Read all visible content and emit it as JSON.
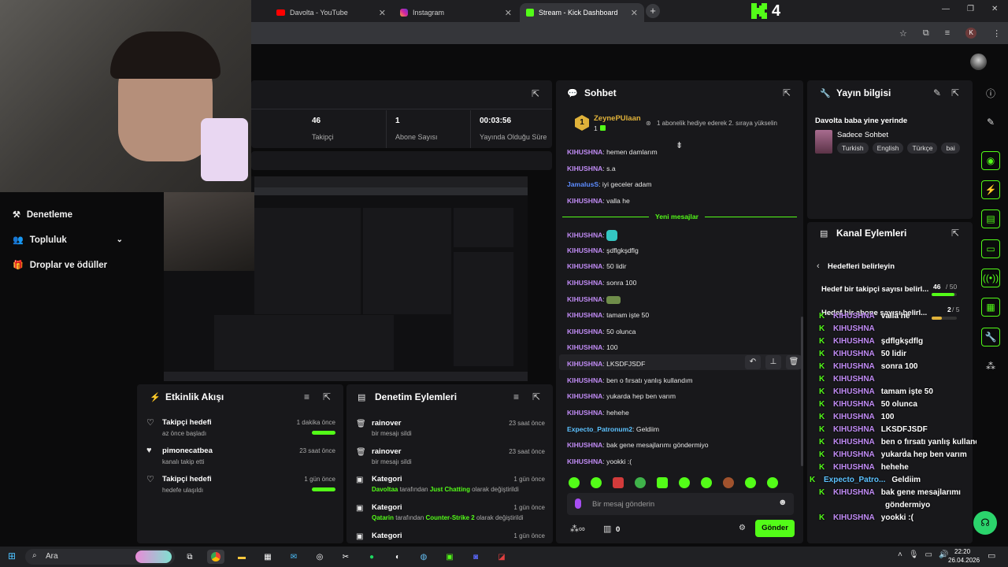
{
  "browser": {
    "tabs": [
      {
        "label": "Davolta - YouTube",
        "icon": "youtube-icon"
      },
      {
        "label": "Instagram",
        "icon": "instagram-icon"
      },
      {
        "label": "Stream - Kick Dashboard",
        "icon": "kick-icon"
      }
    ],
    "logo_text": "4",
    "profile_initial": "K"
  },
  "sidebar": {
    "items": [
      {
        "label": "Denetleme",
        "icon": "shield-icon"
      },
      {
        "label": "Topluluk",
        "icon": "community-icon"
      },
      {
        "label": "Droplar ve ödüller",
        "icon": "gift-icon"
      }
    ]
  },
  "stats": {
    "followers_value": "46",
    "followers_label": "Takipçi",
    "subs_value": "1",
    "subs_label": "Abone Sayısı",
    "uptime_value": "00:03:56",
    "uptime_label": "Yayında Olduğu Süre"
  },
  "chat": {
    "title": "Sohbet",
    "pinned_user": "ZeynePUlaan",
    "pinned_rank": "1",
    "pinned_count": "1",
    "pinned_text": "1 abonelik hediye ederek 2. sıraya yükselin",
    "new_messages_label": "Yeni mesajlar",
    "messages_before": [
      {
        "user": "KIHUSHNA",
        "text": "hemen damlarım"
      },
      {
        "user": "KIHUSHNA",
        "text": "s.a"
      },
      {
        "user": "JamalusS",
        "text": "iyi geceler adam"
      },
      {
        "user": "KIHUSHNA",
        "text": "valla he"
      }
    ],
    "messages_after": [
      {
        "user": "KIHUSHNA",
        "text": ""
      },
      {
        "user": "KIHUSHNA",
        "text": "şdflgkşdflg"
      },
      {
        "user": "KIHUSHNA",
        "text": "50 lidir"
      },
      {
        "user": "KIHUSHNA",
        "text": "sonra 100"
      },
      {
        "user": "KIHUSHNA",
        "text": ""
      },
      {
        "user": "KIHUSHNA",
        "text": "tamam işte 50"
      },
      {
        "user": "KIHUSHNA",
        "text": "50 olunca"
      },
      {
        "user": "KIHUSHNA",
        "text": "100"
      },
      {
        "user": "KIHUSHNA",
        "text": "LKSDFJSDF"
      },
      {
        "user": "KIHUSHNA",
        "text": "ben o fırsatı yanlış kullandım"
      },
      {
        "user": "KIHUSHNA",
        "text": "yukarda hep ben varım"
      },
      {
        "user": "KIHUSHNA",
        "text": "hehehe"
      },
      {
        "user": "Expecto_Patronum2",
        "text": "Geldiim"
      },
      {
        "user": "KIHUSHNA",
        "text": "bak gene mesajlarımı göndermiyo"
      },
      {
        "user": "KIHUSHNA",
        "text": "yookki :("
      }
    ],
    "input_placeholder": "Bir mesaj gönderin",
    "points_value": "0",
    "send_label": "Gönder"
  },
  "stream_info": {
    "title": "Yayın bilgisi",
    "stream_title": "Davolta baba yine yerinde",
    "category": "Sadece Sohbet",
    "tags": [
      "Turkish",
      "English",
      "Türkçe",
      "bai"
    ]
  },
  "channel_actions": {
    "title": "Kanal Eylemleri",
    "back_label": "Hedefleri belirleyin",
    "goal1_label": "Hedef bir takipçi sayısı belirl...",
    "goal1_current": "46",
    "goal1_target": "/ 50",
    "goal1_progress": 0.92,
    "goal2_label": "Hedef bir abone sayısı belirl...",
    "goal2_current": "2",
    "goal2_target": "/ 5",
    "goal2_progress": 0.4
  },
  "overlay_chat": [
    {
      "user": "KIHUSHNA",
      "text": "valla he"
    },
    {
      "user": "KIHUSHNA",
      "text": ""
    },
    {
      "user": "KIHUSHNA",
      "text": "şdflgkşdflg"
    },
    {
      "user": "KIHUSHNA",
      "text": "50 lidir"
    },
    {
      "user": "KIHUSHNA",
      "text": "sonra 100"
    },
    {
      "user": "KIHUSHNA",
      "text": ""
    },
    {
      "user": "KIHUSHNA",
      "text": "tamam işte 50"
    },
    {
      "user": "KIHUSHNA",
      "text": "50 olunca"
    },
    {
      "user": "KIHUSHNA",
      "text": "100"
    },
    {
      "user": "KIHUSHNA",
      "text": "LKSDFJSDF"
    },
    {
      "user": "KIHUSHNA",
      "text": "ben o fırsatı yanlış kullandım"
    },
    {
      "user": "KIHUSHNA",
      "text": "yukarda hep ben varım"
    },
    {
      "user": "KIHUSHNA",
      "text": "hehehe"
    },
    {
      "user": "Expecto_Patro...",
      "text": "Geldiim"
    },
    {
      "user": "KIHUSHNA",
      "text": "bak gene mesajlarımı"
    },
    {
      "user": "",
      "text": "göndermiyo"
    },
    {
      "user": "KIHUSHNA",
      "text": "yookki :("
    }
  ],
  "activity": {
    "title": "Etkinlik Akışı",
    "items": [
      {
        "title": "Takipçi hedefi",
        "sub": "az önce başladı",
        "time": "1 dakika önce",
        "progress": true
      },
      {
        "title": "pimonecatbea",
        "sub": "kanalı takip etti",
        "time": "23 saat önce",
        "progress": false
      },
      {
        "title": "Takipçi hedefi",
        "sub": "hedefe ulaşıldı",
        "time": "1 gün önce",
        "progress": true
      }
    ]
  },
  "moderation": {
    "title": "Denetim Eylemleri",
    "items": [
      {
        "title": "rainover",
        "sub": "bir mesajı sildi",
        "time": "23 saat önce"
      },
      {
        "title": "rainover",
        "sub": "bir mesajı sildi",
        "time": "23 saat önce"
      },
      {
        "title": "Kategori",
        "sub_user": "Davoltaa",
        "sub_mid": " tarafından ",
        "sub_cat": "Just Chatting",
        "sub_end": " olarak değiştirildi",
        "time": "1 gün önce"
      },
      {
        "title": "Kategori",
        "sub_user": "Qatarin",
        "sub_mid": " tarafından ",
        "sub_cat": "Counter-Strike 2",
        "sub_end": " olarak değiştirildi",
        "time": "1 gün önce"
      },
      {
        "title": "Kategori",
        "time": "1 gün önce"
      }
    ]
  },
  "taskbar": {
    "search_placeholder": "Ara",
    "time": "22:20",
    "date": "26.04.2026"
  }
}
